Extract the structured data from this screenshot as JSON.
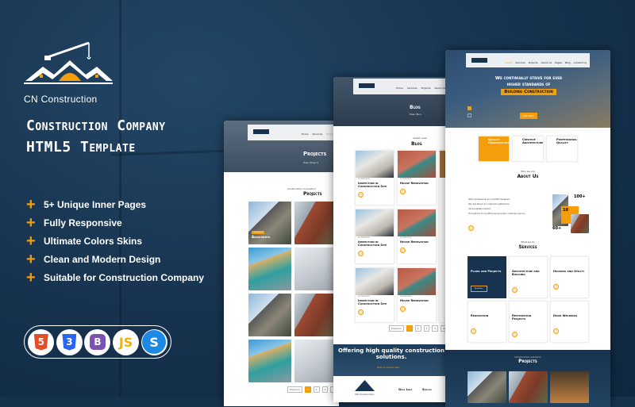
{
  "brand": {
    "name": "CN Construction",
    "accent": "#f59e0b",
    "background": "#17334f"
  },
  "headline": {
    "line1": "Construction Company",
    "line2": "HTML5 Template"
  },
  "features": [
    "5+ Unique Inner Pages",
    "Fully Responsive",
    "Ultimate Colors Skins",
    "Clean and Modern Design",
    "Suitable for Construction Company"
  ],
  "techs": [
    {
      "icon": "html5-icon",
      "label": "5"
    },
    {
      "icon": "css3-icon",
      "label": "3"
    },
    {
      "icon": "bootstrap-icon",
      "label": "B"
    },
    {
      "icon": "javascript-icon",
      "label": "JS"
    },
    {
      "icon": "sass-icon",
      "label": "S"
    }
  ],
  "nav": [
    "Home",
    "Services",
    "Projects",
    "About Us",
    "Pages",
    "Blog",
    "Contact Us"
  ],
  "home": {
    "hero_line1": "We continually strive for ever",
    "hero_line2": "higher standards of",
    "hero_highlight": "Building Construction",
    "hero_button": "Get Start",
    "feature_cards": [
      "Quality Construction",
      "Creative Architecture",
      "Professional Quality"
    ],
    "about_tag": "Who we are",
    "about_title": "About Us",
    "about_points": [
      "We're professional and certified designers",
      "We care about our customers satisfaction",
      "All-acceptable solution",
      "Through the focus efforts we provided customers service"
    ],
    "stats": [
      "100+",
      "10",
      "60+"
    ],
    "services_tag": "What we do",
    "services_title": "Services",
    "services": [
      "Plans and Projects",
      "Architecture and Building",
      "Housing and Utility",
      "Renovation",
      "Restoration Projects",
      "Door Weldings"
    ],
    "read_more": "Read More",
    "projects_tag": "Construction solutions",
    "projects_title": "Projects"
  },
  "blog": {
    "banner": "Blog",
    "breadcrumb": "Home / Blog",
    "tag": "Latest news",
    "title": "Blog",
    "category": "Architecture",
    "posts": [
      "Inspection in Construction Site",
      "House Renovation",
      "Inspection in Construction Site",
      "House Renovation",
      "Inspection in Construction Site",
      "House Renovation"
    ],
    "pagination": [
      "Previous",
      "1",
      "2",
      "3",
      "4",
      "Next"
    ],
    "cta": "Offering high quality construction solutions.",
    "cta_button": "Make Your Dream Real",
    "footer_cols": [
      "Quick Links",
      "Services"
    ],
    "footer_brand": "CN Construction"
  },
  "projects": {
    "banner": "Projects",
    "breadcrumb": "Home / Projects",
    "tag": "Construction Innovation",
    "title": "Projects",
    "featured_badge": "Our Projects",
    "featured_title": "Apartments",
    "featured_sub": "Building",
    "pagination": [
      "Previous",
      "1",
      "2",
      "3",
      "4"
    ]
  }
}
